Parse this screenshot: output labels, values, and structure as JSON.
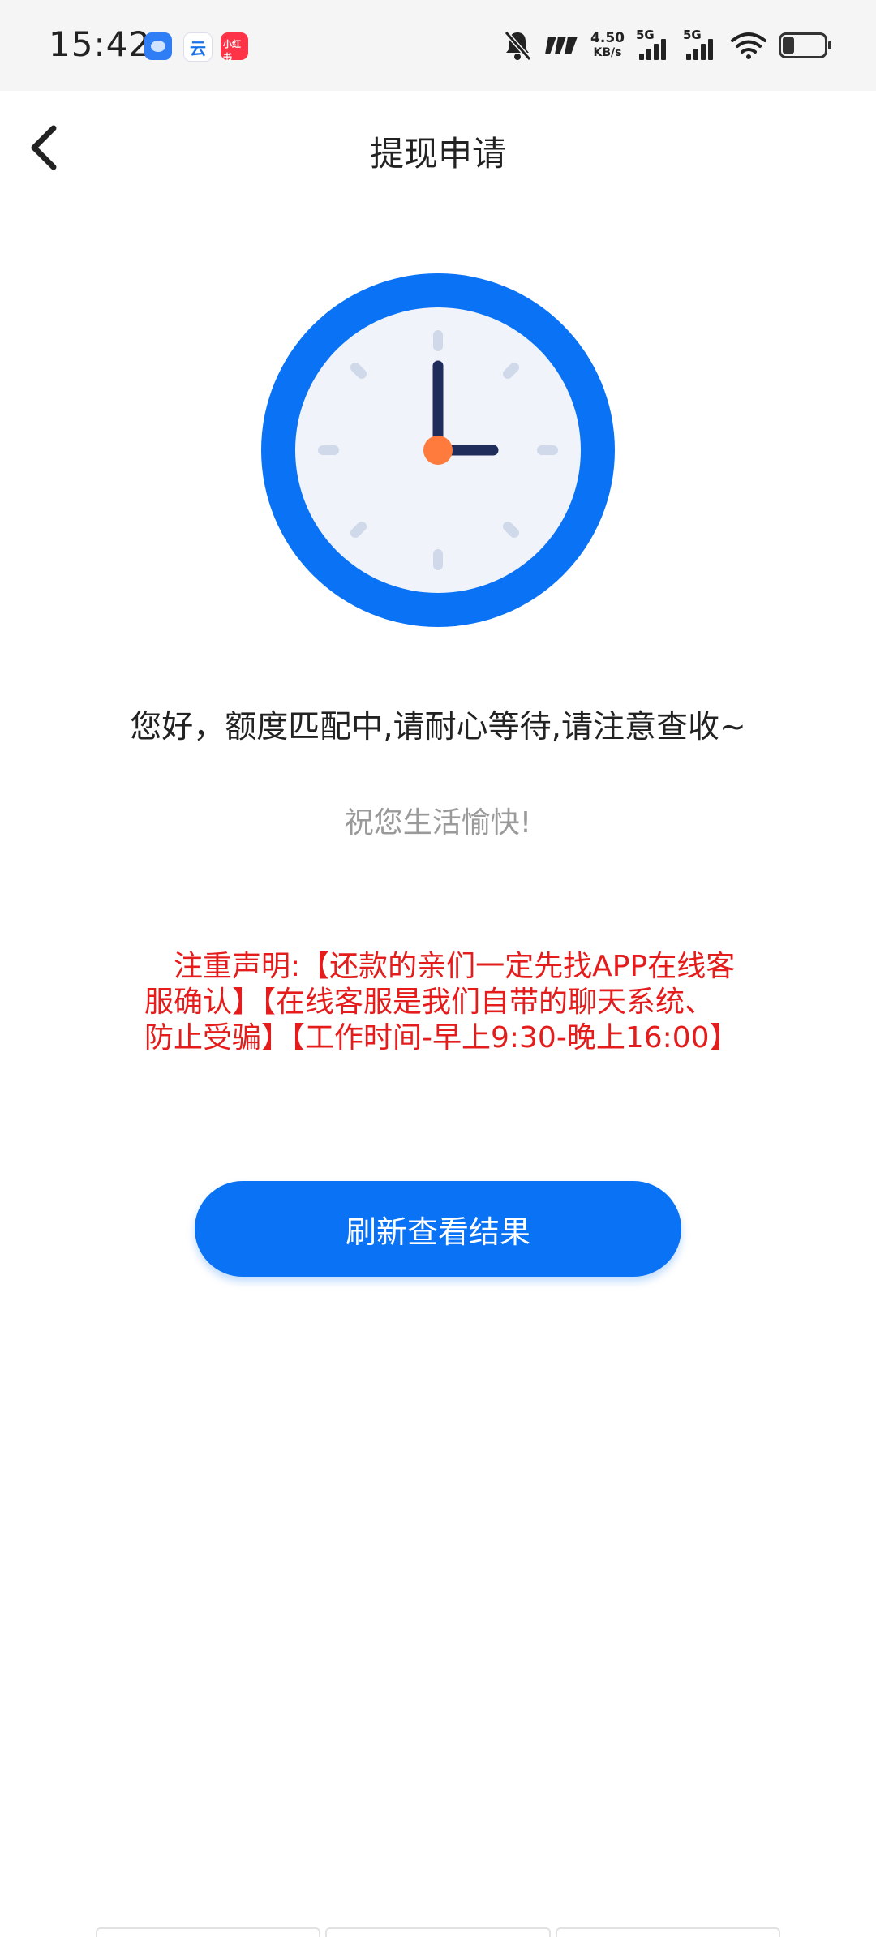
{
  "status_bar": {
    "time": "15:42",
    "net_speed": "4.50",
    "net_unit": "KB/s",
    "signal1_label": "5G",
    "signal2_label": "5G",
    "app3_label": "小红书",
    "app2_label": "云"
  },
  "header": {
    "title": "提现申请"
  },
  "main": {
    "message": "您好，额度匹配中,请耐心等待,请注意查收~",
    "sub_message": "祝您生活愉快!",
    "notice": "注重声明:【还款的亲们一定先找APP在线客服确认】【在线客服是我们自带的聊天系统、防止受骗】【工作时间-早上9:30-晚上16:00】",
    "refresh_button": "刷新查看结果"
  },
  "colors": {
    "accent": "#0a72f5",
    "clock_ring": "#0a72f5",
    "clock_face": "#f0f4fa",
    "clock_hand": "#1f2d5c",
    "clock_center": "#ff7a3d",
    "notice": "#e51c1c"
  },
  "icons": {
    "back": "chevron-left-icon",
    "clock": "clock-icon",
    "mute": "bell-off-icon",
    "wifi": "wifi-icon",
    "battery": "battery-icon"
  }
}
